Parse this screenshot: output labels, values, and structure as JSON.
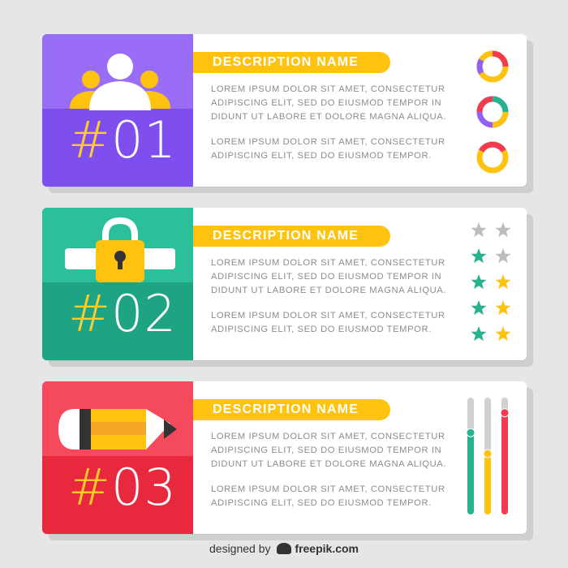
{
  "banners": [
    {
      "number_hash": "#",
      "number_digits": "01",
      "title": "DESCRIPTION NAME",
      "para1": "LOREM IPSUM DOLOR SIT AMET, CONSECTETUR ADIPISCING ELIT, SED DO EIUSMOD TEMPOR IN DIDUNT UT LABORE ET DOLORE MAGNA ALIQUA.",
      "para2": "LOREM IPSUM DOLOR SIT AMET, CONSECTETUR ADIPISCING ELIT, SED DO EIUSMOD TEMPOR.",
      "color": "#8f62f5",
      "icon": "people-group-icon",
      "widget": "donut-charts"
    },
    {
      "number_hash": "#",
      "number_digits": "02",
      "title": "DESCRIPTION NAME",
      "para1": "LOREM IPSUM DOLOR SIT AMET, CONSECTETUR ADIPISCING ELIT, SED DO EIUSMOD TEMPOR IN DIDUNT UT LABORE ET DOLORE MAGNA ALIQUA.",
      "para2": "LOREM IPSUM DOLOR SIT AMET, CONSECTETUR ADIPISCING ELIT, SED DO EIUSMOD TEMPOR.",
      "color": "#26b391",
      "icon": "padlock-icon",
      "widget": "star-rating-grid"
    },
    {
      "number_hash": "#",
      "number_digits": "03",
      "title": "DESCRIPTION NAME",
      "para1": "LOREM IPSUM DOLOR SIT AMET, CONSECTETUR ADIPISCING ELIT, SED DO EIUSMOD TEMPOR IN DIDUNT UT LABORE ET DOLORE MAGNA ALIQUA.",
      "para2": "LOREM IPSUM DOLOR SIT AMET, CONSECTETUR ADIPISCING ELIT, SED DO EIUSMOD TEMPOR.",
      "color": "#f23b4e",
      "icon": "pencil-icon",
      "widget": "vertical-sliders"
    }
  ],
  "colors": {
    "accent_yellow": "#ffc20e",
    "purple": "#8f62f5",
    "green": "#26b391",
    "red": "#f23b4e",
    "gray_star": "#bdbdbd"
  },
  "stars": [
    [
      "gray",
      "gray"
    ],
    [
      "green",
      "gray"
    ],
    [
      "green",
      "yellow"
    ],
    [
      "green",
      "yellow"
    ],
    [
      "green",
      "yellow"
    ]
  ],
  "sliders": [
    {
      "color": "#26b391",
      "level": 0.7
    },
    {
      "color": "#ffc20e",
      "level": 0.52
    },
    {
      "color": "#f23b4e",
      "level": 0.87
    }
  ],
  "footer": {
    "designed_by": "designed by",
    "brand": "freepik.com"
  }
}
